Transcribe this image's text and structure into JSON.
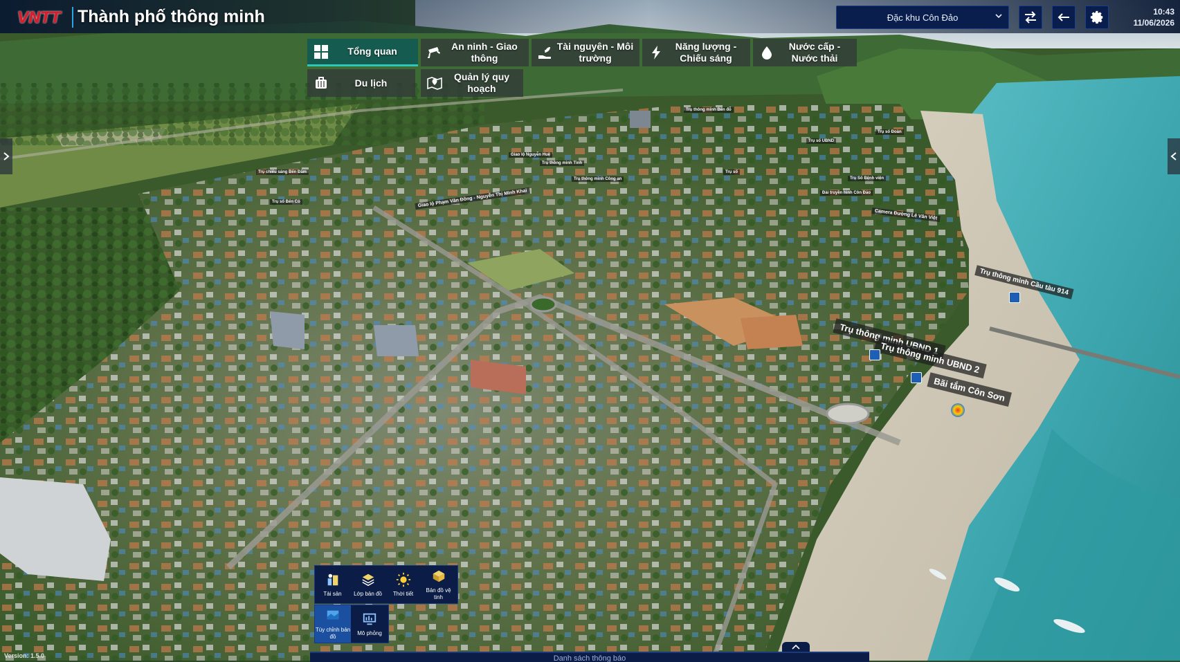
{
  "header": {
    "logo_text": "VNTT",
    "title": "Thành phố thông minh",
    "region_select": "Đặc khu Côn Đảo",
    "time": "10:43",
    "date": "11/06/2026"
  },
  "category_tabs": [
    {
      "label": "Tổng quan",
      "icon": "grid-icon",
      "active": true
    },
    {
      "label": "An ninh - Giao thông",
      "icon": "cctv-camera-icon",
      "active": false
    },
    {
      "label": "Tài nguyên - Môi trường",
      "icon": "hand-plant-icon",
      "active": false
    },
    {
      "label": "Năng lượng - Chiếu sáng",
      "icon": "lightning-icon",
      "active": false
    },
    {
      "label": "Nước cấp - Nước thải",
      "icon": "water-drop-icon",
      "active": false
    },
    {
      "label": "Du lịch",
      "icon": "luggage-icon",
      "active": false
    },
    {
      "label": "Quản lý quy hoạch",
      "icon": "map-pin-icon",
      "active": false
    }
  ],
  "map_labels": {
    "ubnd1": "Trụ thông minh UBND 1",
    "ubnd2": "Trụ thông minh UBND 2",
    "beach": "Bãi tắm Côn Sơn",
    "cau_tau": "Trụ thông minh Cầu tàu 914",
    "camera": "Camera Đường Lê Văn Việt",
    "giao_lo": "Giao lộ Phạm Văn Đồng - Nguyễn Thị Minh Khai",
    "small1": "Trụ thông minh Tỉnh",
    "small2": "Trụ thông minh Công an",
    "small3": "Trụ số",
    "small4": "Trụ Số Bệnh viện",
    "small5": "Trụ chiếu sáng Bến Đầm",
    "small6": "Trụ số Bến Cỏ",
    "small7": "Giao lộ Nguyễn Huệ",
    "small8": "Đài truyền hình Côn Đảo",
    "small9": "Trụ số UBND",
    "small10": "Trụ số Đoàn",
    "small11": "Trụ thông minh Bến đỗ"
  },
  "toolbar": {
    "row1": [
      {
        "label": "Tài sản",
        "icon": "assets-icon"
      },
      {
        "label": "Lớp bản đồ",
        "icon": "layers-icon"
      },
      {
        "label": "Thời tiết",
        "icon": "sun-icon"
      },
      {
        "label": "Bản đồ vệ tinh",
        "icon": "satellite-map-icon"
      }
    ],
    "row2": [
      {
        "label": "Tùy chỉnh bản đồ",
        "icon": "map-custom-icon",
        "selected": true
      },
      {
        "label": "Mô phỏng",
        "icon": "simulation-icon",
        "selected": false
      }
    ]
  },
  "footer": {
    "version": "Version: 1.5.0",
    "notification_bar": "Danh sách thông báo"
  },
  "colors": {
    "header_bg": "#0a1e4e",
    "active_tab": "#125a52",
    "active_tab_line": "#2ec7b5",
    "logo_red": "#d61f2b",
    "accent_blue": "#29a8e0"
  }
}
